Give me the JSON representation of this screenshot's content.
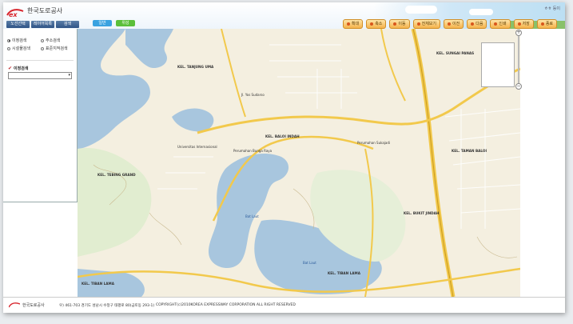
{
  "brand": {
    "mark": "ex",
    "name": "한국도로공사"
  },
  "header": {
    "user_text": "ㅎㅎ 등이",
    "nav_tabs": [
      "노선선택",
      "레이어목록",
      "검색"
    ],
    "mode_buttons": [
      {
        "label": "일반",
        "color": "#3aa2e0"
      },
      {
        "label": "위성",
        "color": "#5bbf3a"
      }
    ],
    "toolbar": [
      "확대",
      "축소",
      "이동",
      "전체보기",
      "이전",
      "다음",
      "인쇄",
      "저장",
      "종료"
    ]
  },
  "sidebar": {
    "radios": [
      {
        "label": "이정검색",
        "checked": true
      },
      {
        "label": "주소검색",
        "checked": false
      },
      {
        "label": "시설물검색",
        "checked": false
      },
      {
        "label": "표준지적검색",
        "checked": false
      }
    ],
    "section_label": "이정검색",
    "select_value": ""
  },
  "map": {
    "labels": [
      {
        "text": "KEL. SUNGAI PANAS",
        "cls": "kel"
      },
      {
        "text": "KEL. TANJUNG UMA",
        "cls": "kel"
      },
      {
        "text": "KEL. BALOI INDAH",
        "cls": "kel"
      },
      {
        "text": "KEL. TAMAN BALOI",
        "cls": "kel"
      },
      {
        "text": "KEL. TEBING GRAND",
        "cls": "kel"
      },
      {
        "text": "KEL. BUKIT JINDAH",
        "cls": "kel"
      },
      {
        "text": "KEL. TIBAN LAMA",
        "cls": "kel"
      },
      {
        "text": "KEL. TIBAN LAMA",
        "cls": "kel"
      },
      {
        "text": "Bat Laut",
        "cls": "water"
      },
      {
        "text": "Bat Laut",
        "cls": "water"
      },
      {
        "text": "Perumahan Bunga Raya",
        "cls": ""
      },
      {
        "text": "Universitas Internasional",
        "cls": ""
      },
      {
        "text": "Jl. Yos Sudarso",
        "cls": ""
      },
      {
        "text": "Perumahan Sukajadi",
        "cls": ""
      }
    ]
  },
  "footer": {
    "logo": "한국도로공사",
    "address": "우) 461-703 경기도 성남시 수정구 태평로 80(금토동 293-1)",
    "copyright": "COPYRIGHT(c)2010KOREA EXPRESSWAY CORPORATION ALL RIGHT RESERVED"
  }
}
